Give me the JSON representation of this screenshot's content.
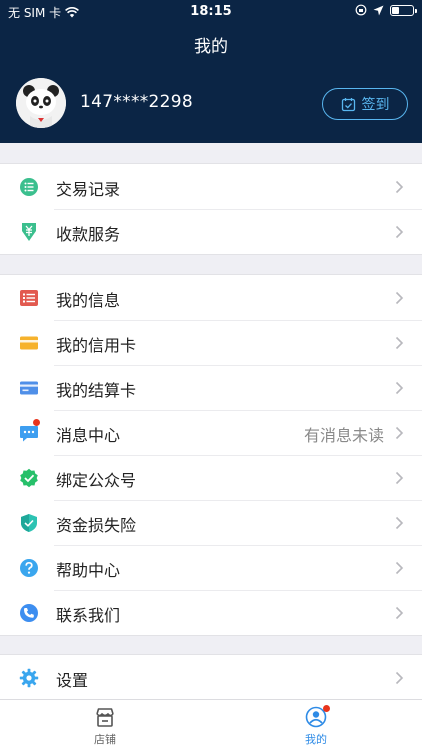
{
  "status_bar": {
    "carrier": "无 SIM 卡",
    "time": "18:15",
    "battery_level": 0.3
  },
  "header": {
    "title": "我的"
  },
  "profile": {
    "phone": "147****2298",
    "signin_label": "签到"
  },
  "groups": [
    {
      "items": [
        {
          "label": "交易记录",
          "icon": "list-circle-icon",
          "color": "#3bbf8e"
        },
        {
          "label": "收款服务",
          "icon": "download-yuan-icon",
          "color": "#3bbf8e"
        }
      ]
    },
    {
      "items": [
        {
          "label": "我的信息",
          "icon": "info-list-icon",
          "color": "#e25a50"
        },
        {
          "label": "我的信用卡",
          "icon": "credit-card-icon",
          "color": "#f6b22c"
        },
        {
          "label": "我的结算卡",
          "icon": "debit-card-icon",
          "color": "#4f8fe8"
        },
        {
          "label": "消息中心",
          "icon": "message-icon",
          "color": "#3d9ef0",
          "extra": "有消息未读"
        },
        {
          "label": "绑定公众号",
          "icon": "verified-badge-icon",
          "color": "#27c06a"
        },
        {
          "label": "资金损失险",
          "icon": "shield-icon",
          "color": "#2dc3b3"
        },
        {
          "label": "帮助中心",
          "icon": "help-icon",
          "color": "#3aa6ee"
        },
        {
          "label": "联系我们",
          "icon": "phone-icon",
          "color": "#3d8ef0"
        }
      ]
    },
    {
      "items": [
        {
          "label": "设置",
          "icon": "gear-icon",
          "color": "#3aa6ee"
        }
      ]
    }
  ],
  "tabbar": {
    "tabs": [
      {
        "label": "店铺",
        "active": false
      },
      {
        "label": "我的",
        "active": true
      }
    ]
  }
}
